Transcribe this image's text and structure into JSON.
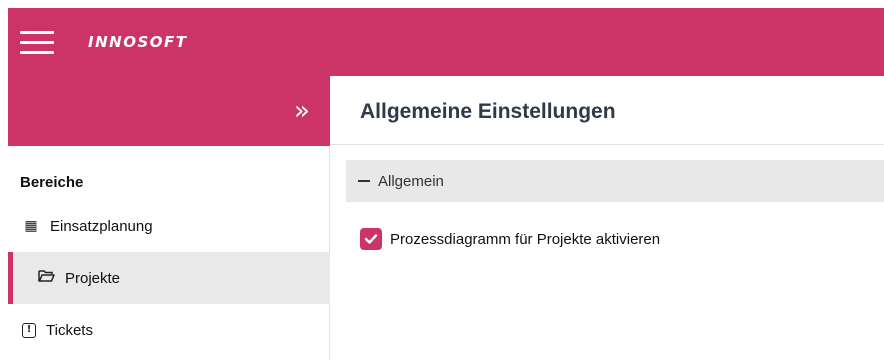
{
  "header": {
    "logo": "INNOSOFT",
    "menu_icon": "hamburger-icon"
  },
  "sidebar": {
    "collapse_icon": "double-chevron-right-icon",
    "collapse_glyph": "»",
    "section_title": "Bereiche",
    "items": [
      {
        "label": "Einsatzplanung",
        "icon": "calendar-icon",
        "glyph": "▦",
        "active": false
      },
      {
        "label": "Projekte",
        "icon": "folder-open-icon",
        "glyph": "🗁",
        "active": true
      },
      {
        "label": "Tickets",
        "icon": "exclamation-box-icon",
        "glyph": "!",
        "active": false
      }
    ]
  },
  "main": {
    "title": "Allgemeine Einstellungen",
    "group": {
      "label": "Allgemein",
      "expanded": true
    },
    "checkbox": {
      "label": "Prozessdiagramm für Projekte aktivieren",
      "checked": true
    }
  },
  "colors": {
    "brand": "#cc3366",
    "active_bg": "#e9e9e9",
    "group_bg": "#e8e8e8"
  }
}
